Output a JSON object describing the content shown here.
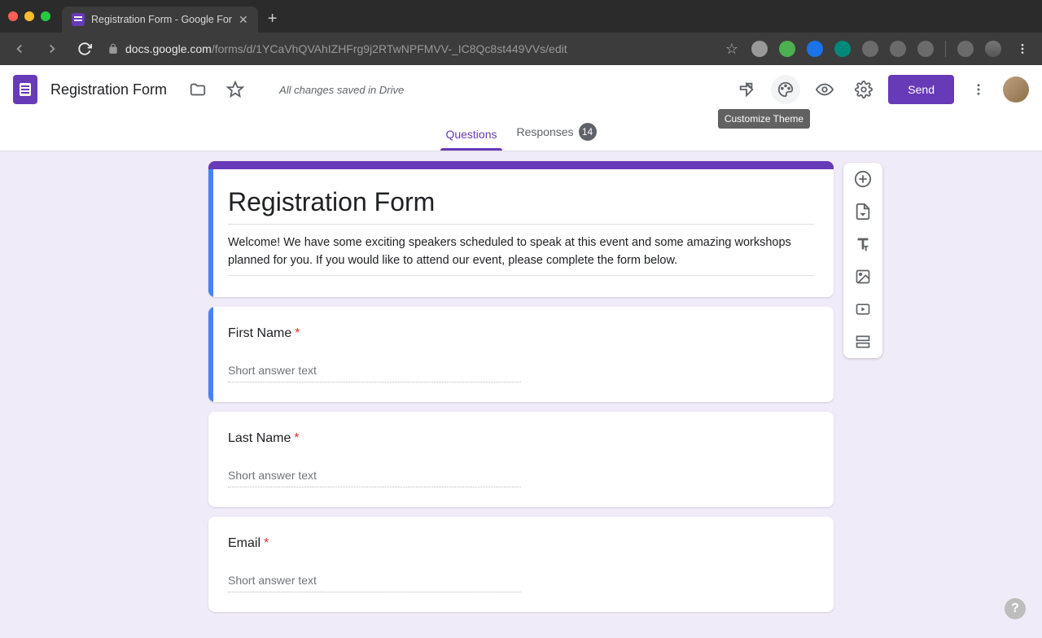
{
  "browser": {
    "tab_title": "Registration Form - Google For",
    "url_host": "docs.google.com",
    "url_path": "/forms/d/1YCaVhQVAhIZHFrg9j2RTwNPFMVV-_IC8Qc8st449VVs/edit"
  },
  "header": {
    "doc_title": "Registration Form",
    "save_message": "All changes saved in Drive",
    "send_label": "Send",
    "tooltip": "Customize Theme"
  },
  "tabs": {
    "questions": "Questions",
    "responses": "Responses",
    "response_count": "14"
  },
  "form": {
    "title": "Registration Form",
    "description": "Welcome! We have some exciting speakers scheduled to speak at this event and some amazing workshops planned for you. If you would like to attend our event, please complete the form below."
  },
  "questions": [
    {
      "label": "First Name",
      "placeholder": "Short answer text",
      "required": "*"
    },
    {
      "label": "Last Name",
      "placeholder": "Short answer text",
      "required": "*"
    },
    {
      "label": "Email",
      "placeholder": "Short answer text",
      "required": "*"
    }
  ],
  "help": "?"
}
